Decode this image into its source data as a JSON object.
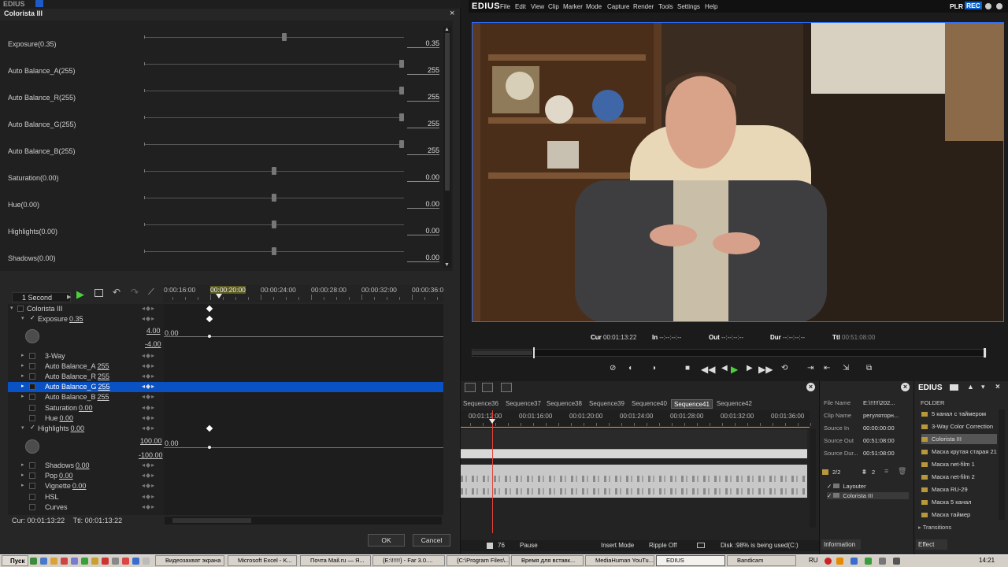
{
  "dialog": {
    "title": "Colorista III",
    "close_label": "×",
    "ok_label": "OK",
    "cancel_label": "Cancel",
    "params": [
      {
        "label": "Exposure(0.35)",
        "value": "0.35",
        "pos": 0.54
      },
      {
        "label": "Auto Balance_A(255)",
        "value": "255",
        "pos": 1.0
      },
      {
        "label": "Auto Balance_R(255)",
        "value": "255",
        "pos": 1.0
      },
      {
        "label": "Auto Balance_G(255)",
        "value": "255",
        "pos": 1.0
      },
      {
        "label": "Auto Balance_B(255)",
        "value": "255",
        "pos": 1.0
      },
      {
        "label": "Saturation(0.00)",
        "value": "0.00",
        "pos": 0.5
      },
      {
        "label": "Hue(0.00)",
        "value": "0.00",
        "pos": 0.5
      },
      {
        "label": "Highlights(0.00)",
        "value": "0.00",
        "pos": 0.5
      },
      {
        "label": "Shadows(0.00)",
        "value": "0.00",
        "pos": 0.5
      }
    ],
    "keyframe": {
      "interval": "1 Second",
      "ruler": [
        "0:00:16:00",
        "00:00:20:00",
        "00:00:24:00",
        "00:00:28:00",
        "00:00:32:00",
        "00:00:36:0"
      ],
      "tree": {
        "root": "Colorista III",
        "exposure": {
          "name": "Exposure",
          "value": "0.35"
        },
        "exposure_max": "4.00",
        "exposure_min": "-4.00",
        "exposure_graph": "0.00",
        "three_way": "3-Way",
        "ab_a": {
          "name": "Auto Balance_A",
          "value": "255"
        },
        "ab_r": {
          "name": "Auto Balance_R",
          "value": "255"
        },
        "ab_g": {
          "name": "Auto Balance_G",
          "value": "255"
        },
        "ab_b": {
          "name": "Auto Balance_B",
          "value": "255"
        },
        "saturation": {
          "name": "Saturation",
          "value": "0.00"
        },
        "hue": {
          "name": "Hue",
          "value": "0.00"
        },
        "highlights": {
          "name": "Highlights",
          "value": "0.00"
        },
        "highlights_max": "100.00",
        "highlights_min": "-100.00",
        "highlights_graph": "0.00",
        "shadows": {
          "name": "Shadows",
          "value": "0.00"
        },
        "pop": {
          "name": "Pop",
          "value": "0.00"
        },
        "vignette": {
          "name": "Vignette",
          "value": "0.00"
        },
        "hsl": "HSL",
        "curves": "Curves"
      },
      "cur_label": "Cur:",
      "cur": "00:01:13:22",
      "ttl_label": "Ttl:",
      "ttl": "00:01:13:22"
    }
  },
  "app": {
    "logo": "EDIUS",
    "menu": [
      "File",
      "Edit",
      "View",
      "Clip",
      "Marker",
      "Mode",
      "Capture",
      "Render",
      "Tools",
      "Settings",
      "Help"
    ],
    "plr": "PLR",
    "rec": "REC"
  },
  "player": {
    "cur_label": "Cur",
    "cur": "00:01:13:22",
    "in_label": "In",
    "in": "--:--:--:--",
    "out_label": "Out",
    "out": "--:--:--:--",
    "dur_label": "Dur",
    "dur": "--:--:--:--",
    "ttl_label": "Ttl",
    "ttl": "00:51:08:00"
  },
  "timeline": {
    "tabs": [
      "Sequence36",
      "Sequence37",
      "Sequence38",
      "Sequence39",
      "Sequence40",
      "Sequence41",
      "Sequence42"
    ],
    "active_tab": "Sequence41",
    "ruler": [
      "00:01:12:00",
      "00:01:16:00",
      "00:01:20:00",
      "00:01:24:00",
      "00:01:28:00",
      "00:01:32:00",
      "00:01:36:00"
    ],
    "status": {
      "zoom": "76",
      "pause": "Pause",
      "insert": "Insert Mode",
      "ripple": "Ripple Off",
      "disk": "Disk :98% is being used(C:)"
    }
  },
  "info": {
    "rows": [
      {
        "k": "File Name",
        "v": "E:\\!!!!!\\202..."
      },
      {
        "k": "Clip Name",
        "v": "регуляторн..."
      },
      {
        "k": "Source In",
        "v": "00:00:00:00"
      },
      {
        "k": "Source Out",
        "v": "00:51:08:00"
      },
      {
        "k": "Source Dur...",
        "v": "00:51:08:00"
      }
    ],
    "page": "2/2",
    "count": "2",
    "filters": [
      "Layouter",
      "Colorista III"
    ],
    "tab": "Information"
  },
  "effect": {
    "logo": "EDIUS",
    "folder": "FOLDER",
    "items": [
      "5 канал с таймером",
      "3-Way Color Correction",
      "Colorista III",
      "Маска крутая старая 21",
      "Маска net-film 1",
      "Маска net-film 2",
      "Маска RU-29",
      "Маска 5 канал",
      "Маска таймер"
    ],
    "selected": "Colorista III",
    "transitions": "Transitions",
    "tab": "Effect"
  },
  "taskbar": {
    "start": "Пуск",
    "tasks": [
      "Видеозахват экрана",
      "Microsoft Excel - K...",
      "Почта Mail.ru — Я...",
      "{E:\\!!!!!} - Far 3.0....",
      "{C:\\Program Files\\...",
      "Время для вставк...",
      "MediaHuman YouTu...",
      "EDIUS",
      "Bandicam"
    ],
    "active": "EDIUS",
    "lang": "RU",
    "time": "14:21"
  }
}
